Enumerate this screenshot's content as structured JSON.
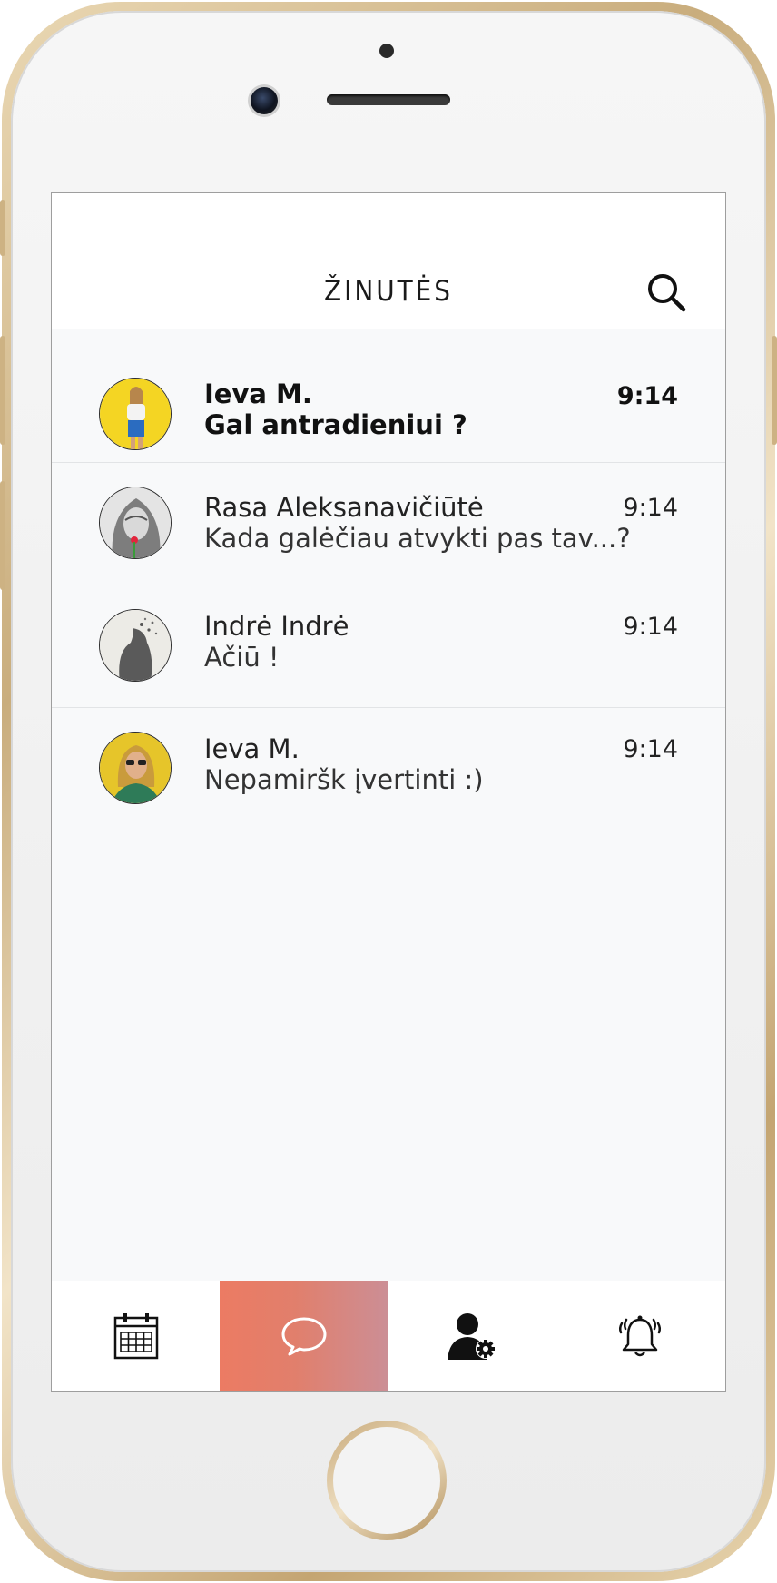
{
  "header": {
    "title": "ŽINUTĖS",
    "search_icon": "search-icon"
  },
  "conversations": [
    {
      "name": "Ieva M.",
      "preview": "Gal antradieniui ?",
      "time": "9:14",
      "unread": true,
      "avatar": "avatar-photo"
    },
    {
      "name": "Rasa Aleksanavičiūtė",
      "preview": "Kada galėčiau atvykti pas tav...?",
      "time": "9:14",
      "unread": false,
      "avatar": "avatar-photo"
    },
    {
      "name": "Indrė Indrė",
      "preview": "Ačiū !",
      "time": "9:14",
      "unread": false,
      "avatar": "avatar-photo"
    },
    {
      "name": "Ieva M.",
      "preview": "Nepamiršk įvertinti :)",
      "time": "9:14",
      "unread": false,
      "avatar": "avatar-photo"
    }
  ],
  "tabs": [
    {
      "icon": "calendar-icon",
      "active": false
    },
    {
      "icon": "chat-bubble-icon",
      "active": true
    },
    {
      "icon": "user-settings-icon",
      "active": false
    },
    {
      "icon": "bell-ringing-icon",
      "active": false
    }
  ],
  "colors": {
    "active_tab_start": "#ec7b63",
    "active_tab_end": "#cc8e95",
    "list_background": "#f8f9fa",
    "phone_frame_gold": "#c9ad7d"
  }
}
